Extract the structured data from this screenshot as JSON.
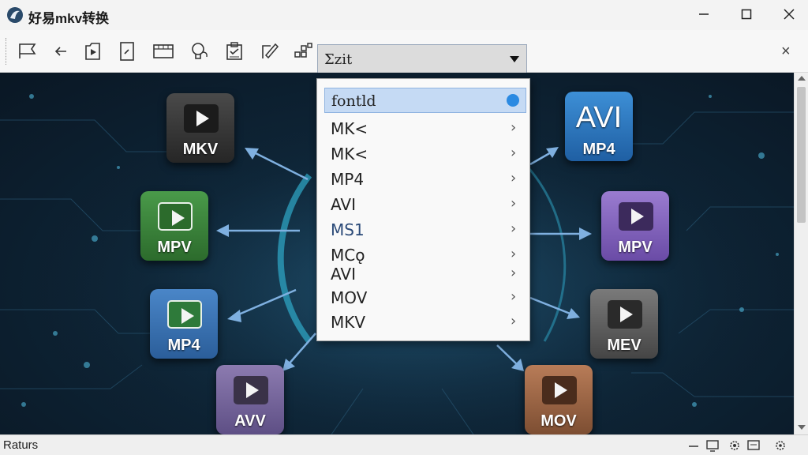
{
  "window": {
    "title": "好易mkv转换",
    "controls": {
      "minimize": "minimize",
      "maximize": "maximize",
      "close": "close"
    }
  },
  "toolbar": {
    "icons": [
      "flag-icon",
      "back-arrow-icon",
      "export-play-icon",
      "document-icon",
      "film-strip-icon",
      "lightbulb-icon",
      "checklist-icon",
      "edit-icon",
      "grid-icon"
    ],
    "format_combo": {
      "value": "Σzit"
    },
    "close_label": "×"
  },
  "dropdown": {
    "items": [
      {
        "label": "fontld",
        "selected": true,
        "badge": "blue-drop-icon"
      },
      {
        "label": "MK<",
        "chevron": "›"
      },
      {
        "label": "MK<",
        "chevron": "›"
      },
      {
        "label": "MP4",
        "chevron": "›"
      },
      {
        "label": "AVI",
        "chevron": "›"
      },
      {
        "label": "MS1",
        "chevron": "›"
      },
      {
        "label": "MCǫ",
        "chevron": "›"
      },
      {
        "label": "AVI",
        "chevron": "›"
      },
      {
        "label": "MOV",
        "chevron": "›"
      },
      {
        "label": "MKV",
        "chevron": "›"
      }
    ]
  },
  "tiles": {
    "left": [
      {
        "label": "MKV",
        "color": "#3a3a3a"
      },
      {
        "label": "MPV",
        "color": "#3e8a3e"
      },
      {
        "label": "MP4",
        "color": "#3a78bd"
      },
      {
        "label": "AVV",
        "color": "#7a6aa0"
      }
    ],
    "right": [
      {
        "title": "AVI",
        "label": "MP4",
        "color": "#2f7cc4"
      },
      {
        "label": "MPV",
        "color": "#8866c0"
      },
      {
        "label": "MEV",
        "color": "#5e5e5e"
      },
      {
        "label": "MOV",
        "color": "#a06a48"
      }
    ]
  },
  "status": {
    "text": "Raturs",
    "icons": [
      "minus-icon",
      "monitor-icon",
      "settings-icon",
      "screen-icon",
      "gear-icon"
    ]
  },
  "colors": {
    "accent": "#2b8ae2",
    "background": "#0e2537",
    "selection": "#c5daf4"
  }
}
